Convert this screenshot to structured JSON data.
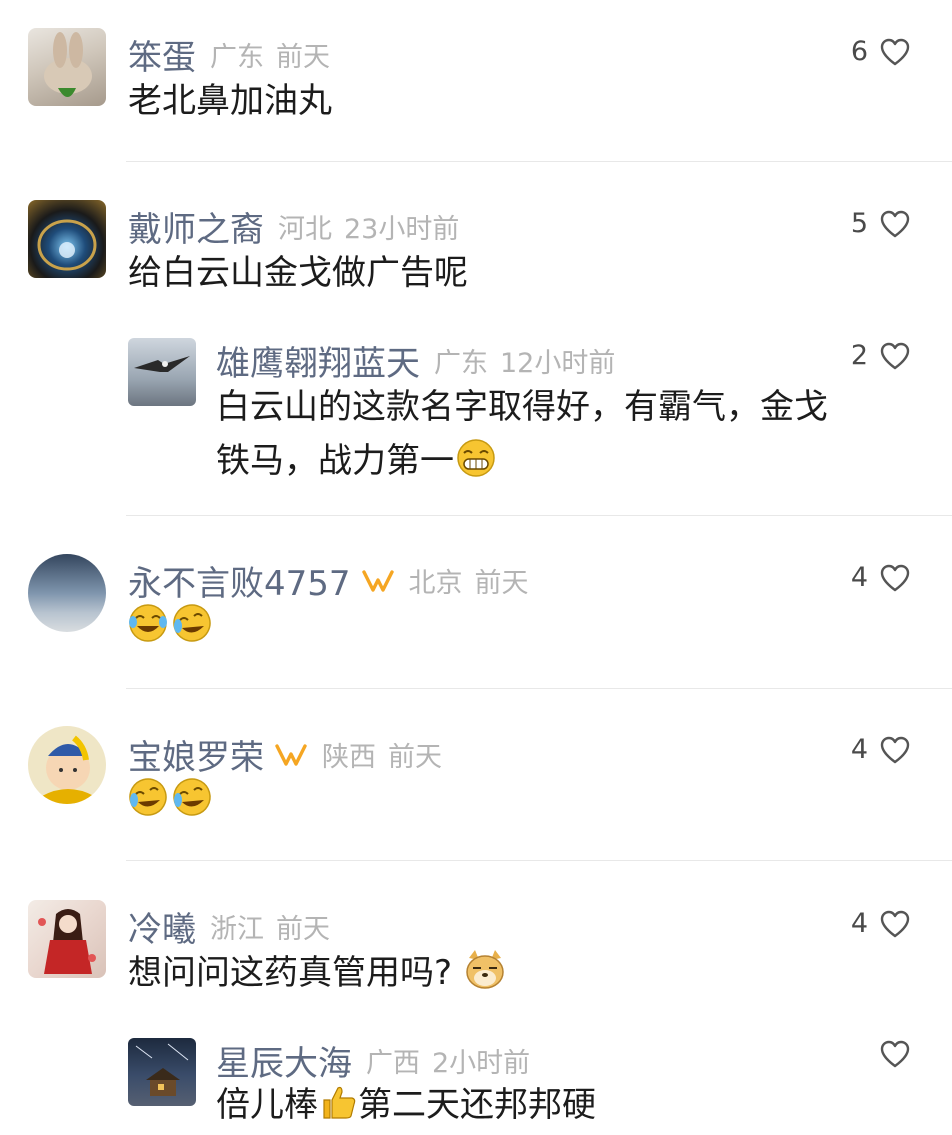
{
  "comments": [
    {
      "name": "笨蛋",
      "location": "广东",
      "time": "前天",
      "likes": "6",
      "text": "老北鼻加油丸"
    },
    {
      "name": "戴师之裔",
      "location": "河北",
      "time": "23小时前",
      "likes": "5",
      "text": "给白云山金戈做广告呢",
      "reply": {
        "name": "雄鹰翱翔蓝天",
        "location": "广东",
        "time": "12小时前",
        "likes": "2",
        "line1": "白云山的这款名字取得好，有霸气，金戈",
        "line2": "铁马，战力第一"
      }
    },
    {
      "name": "永不言败4757",
      "location": "北京",
      "time": "前天",
      "likes": "4",
      "text": ""
    },
    {
      "name": "宝娘罗荣",
      "location": "陕西",
      "time": "前天",
      "likes": "4",
      "text": ""
    },
    {
      "name": "冷曦",
      "location": "浙江",
      "time": "前天",
      "likes": "4",
      "text": "想问问这药真管用吗?",
      "reply": {
        "name": "星辰大海",
        "location": "广西",
        "time": "2小时前",
        "likes": "",
        "text_a": "倍儿棒",
        "text_b": "第二天还邦邦硬"
      }
    }
  ],
  "colors": {
    "name": "#5e6a82",
    "meta": "#b4b4b4",
    "vip": "#f5a623",
    "divider": "#e8e8e8"
  }
}
